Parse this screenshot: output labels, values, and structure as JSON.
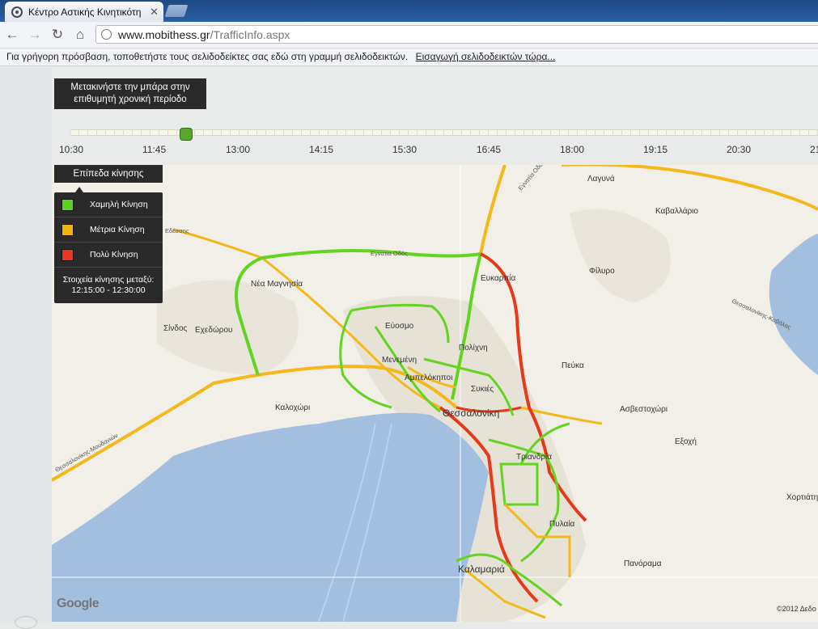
{
  "browser": {
    "tab_title": "Κέντρο Αστικής Κινητικότη",
    "url_host": "www.mobithess.gr",
    "url_path": "/TrafficInfo.aspx",
    "bookmark_hint": "Για γρήγορη πρόσβαση, τοποθετήστε τους σελιδοδείκτες σας εδώ στη γραμμή σελιδοδεικτών.",
    "bookmark_link": "Εισαγωγή σελιδοδεικτών τώρα..."
  },
  "timeline": {
    "hint": "Μετακινήστε την μπάρα στην επιθυμητή χρονική περίοδο",
    "labels": [
      "10:30",
      "11:45",
      "13:00",
      "14:15",
      "15:30",
      "16:45",
      "18:00",
      "19:15",
      "20:30",
      "21"
    ]
  },
  "legend": {
    "title": "Επίπεδα κίνησης",
    "items": [
      {
        "label": "Χαμηλή Κίνηση",
        "color": "#5ad31a"
      },
      {
        "label": "Μέτρια Κίνηση",
        "color": "#f2b40c"
      },
      {
        "label": "Πολύ Κίνηση",
        "color": "#e8381a"
      }
    ],
    "note_label": "Στοιχεία κίνησης μεταξύ:",
    "note_range": "12:15:00 - 12:30:00"
  },
  "map": {
    "places": [
      "Λαγυνά",
      "Καβαλλάριο",
      "Φίλυρο",
      "Ευκαρπία",
      "Νέα Μαγνησία",
      "Εύοσμο",
      "Πολίχνη",
      "Μενεμένη",
      "Αμπελόκηποι",
      "Συκιές",
      "Θεσσαλονίκη",
      "Σίνδος",
      "Εχεδώρου",
      "Καλοχώρι",
      "Πεύκα",
      "Ασβεστοχώρι",
      "Εξοχή",
      "Τριανδρία",
      "Πυλαία",
      "Καλαμαριά",
      "Πανόραμα",
      "Χορτιάτης"
    ],
    "roads": [
      "Εγνατία Οδός",
      "Εγνατία Οδός",
      "Θεσσαλονίκης-Καβάλας",
      "Θεσσαλονίκης-Μουδανιών",
      "Εδέσσης"
    ],
    "logo": "Google",
    "copyright": "©2012 Δεδο"
  }
}
